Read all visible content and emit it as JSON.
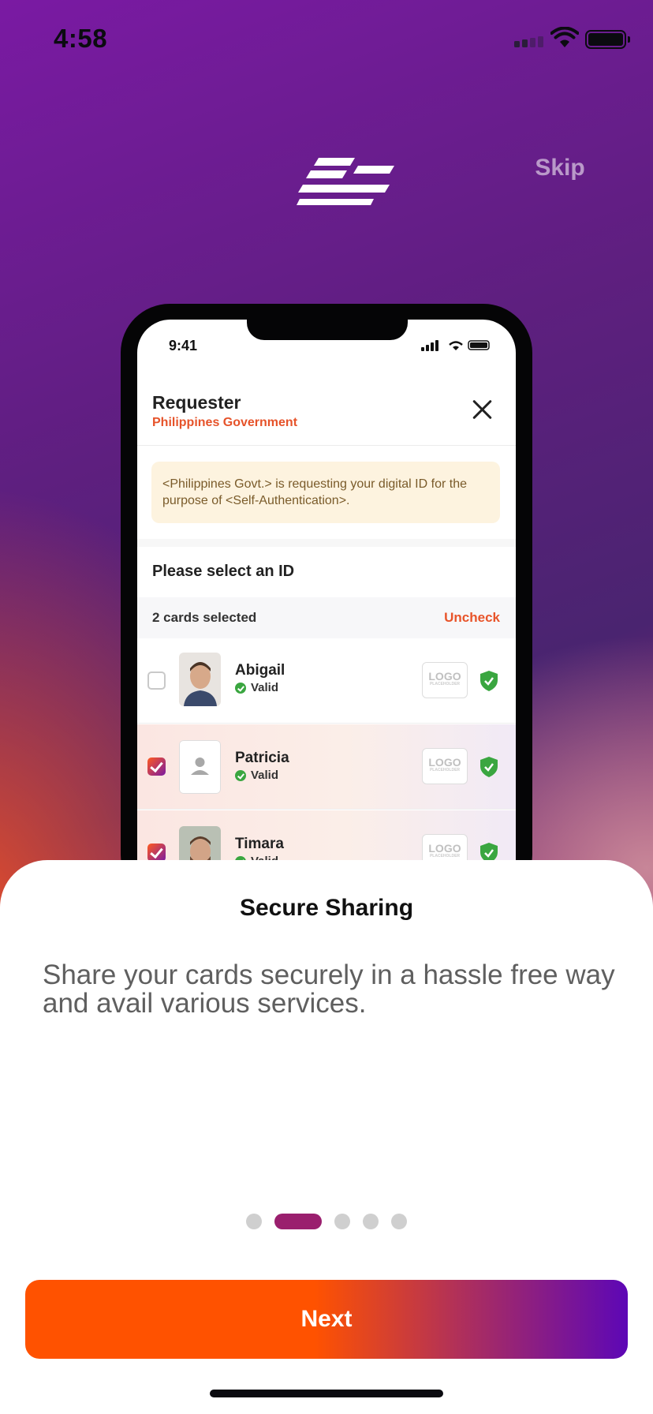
{
  "status_bar": {
    "time": "4:58",
    "icons": [
      "cellular-signal-icon",
      "wifi-icon",
      "battery-icon"
    ]
  },
  "header": {
    "logo": "app-logo-icon",
    "skip_label": "Skip"
  },
  "mockup": {
    "time": "9:41",
    "title": "Requester",
    "subtitle": "Philippines Government",
    "banner_text": "<Philippines Govt.> is requesting your digital ID for the purpose of <Self-Authentication>.",
    "select_title": "Please select an ID",
    "selected_count": "2 cards selected",
    "uncheck_label": "Uncheck",
    "logo_placeholder": "LOGO",
    "logo_placeholder_sub": "PLACEHOLDER",
    "cards": [
      {
        "name": "Abigail",
        "status": "Valid",
        "checked": false
      },
      {
        "name": "Patricia",
        "status": "Valid",
        "checked": true
      },
      {
        "name": "Timara",
        "status": "Valid",
        "checked": true
      }
    ]
  },
  "onboarding": {
    "title": "Secure Sharing",
    "description": "Share your cards securely in a hassle free way and avail various services.",
    "pages_total": 5,
    "current_page": 2,
    "next_label": "Next"
  },
  "colors": {
    "accent_orange": "#ff5200",
    "accent_purple": "#5d07b6",
    "active_dot": "#9a1f6e",
    "valid_green": "#3aa640"
  }
}
